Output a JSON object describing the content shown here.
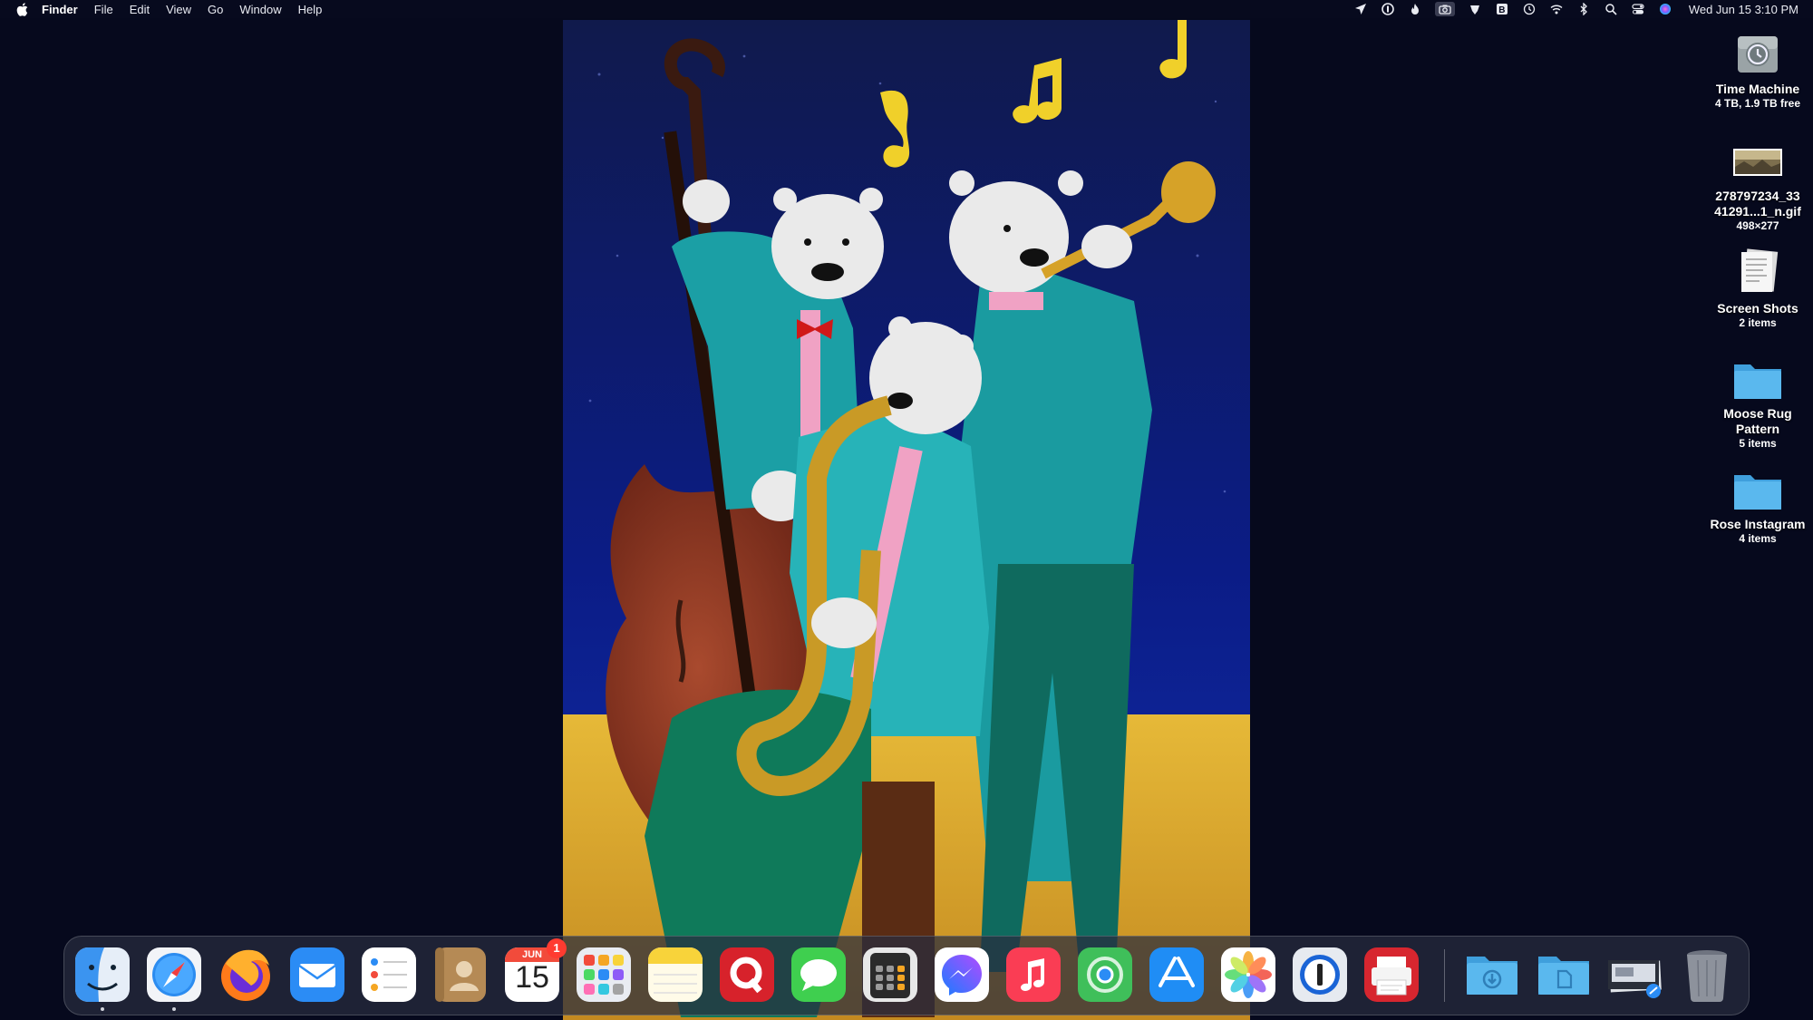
{
  "menubar": {
    "app_name": "Finder",
    "items": [
      "File",
      "Edit",
      "View",
      "Go",
      "Window",
      "Help"
    ],
    "status_icons": [
      "location-arrow-icon",
      "onepassword-icon",
      "flame-icon",
      "screenshot-camera-icon",
      "dropzone-icon",
      "bbedit-icon",
      "time-machine-icon",
      "wifi-icon",
      "bluetooth-icon",
      "spotlight-search-icon",
      "control-center-icon",
      "siri-icon"
    ],
    "clock": "Wed Jun 15  3:10 PM"
  },
  "desktop": {
    "items": [
      {
        "name": "Time Machine",
        "sub": "4 TB, 1.9 TB free",
        "icon": "time-machine-drive-icon"
      },
      {
        "name": "278797234_33 41291...1_n.gif",
        "sub": "498×277",
        "icon": "image-thumbnail-icon"
      },
      {
        "name": "Screen Shots",
        "sub": "2 items",
        "icon": "document-stack-icon"
      },
      {
        "name": "Moose Rug Pattern",
        "sub": "5 items",
        "icon": "folder-icon"
      },
      {
        "name": "Rose Instagram",
        "sub": "4 items",
        "icon": "folder-icon"
      }
    ]
  },
  "dock": {
    "apps": [
      {
        "name": "Finder",
        "icon": "finder-icon"
      },
      {
        "name": "Safari",
        "icon": "safari-icon"
      },
      {
        "name": "Firefox",
        "icon": "firefox-icon"
      },
      {
        "name": "Mail",
        "icon": "mail-icon"
      },
      {
        "name": "Reminders",
        "icon": "reminders-icon"
      },
      {
        "name": "Contacts",
        "icon": "contacts-icon"
      },
      {
        "name": "Calendar",
        "icon": "calendar-icon"
      },
      {
        "name": "Launchpad",
        "icon": "launchpad-icon"
      },
      {
        "name": "Notes",
        "icon": "notes-icon"
      },
      {
        "name": "Quicken",
        "icon": "quicken-icon"
      },
      {
        "name": "Messages",
        "icon": "messages-icon"
      },
      {
        "name": "Calculator",
        "icon": "calculator-icon"
      },
      {
        "name": "Messenger",
        "icon": "messenger-icon"
      },
      {
        "name": "Music",
        "icon": "music-icon"
      },
      {
        "name": "Find My",
        "icon": "find-my-icon"
      },
      {
        "name": "App Store",
        "icon": "app-store-icon"
      },
      {
        "name": "Photos",
        "icon": "photos-icon"
      },
      {
        "name": "1Password",
        "icon": "onepassword-icon"
      },
      {
        "name": "Printer",
        "icon": "printer-icon"
      },
      {
        "name": "Downloads",
        "icon": "downloads-folder-icon"
      },
      {
        "name": "Documents",
        "icon": "documents-folder-icon"
      },
      {
        "name": "Screenshot stack",
        "icon": "screenshot-stack-icon"
      },
      {
        "name": "Trash",
        "icon": "trash-icon"
      }
    ],
    "calendar": {
      "month": "JUN",
      "day": "15",
      "badge": "1"
    }
  },
  "colors": {
    "desktop_bg": "#06091d",
    "folder_blue": "#5ab8ee",
    "rug_sky": "#0d1a6e",
    "rug_floor": "#d9a72c",
    "rug_teal": "#1aa3a9"
  }
}
